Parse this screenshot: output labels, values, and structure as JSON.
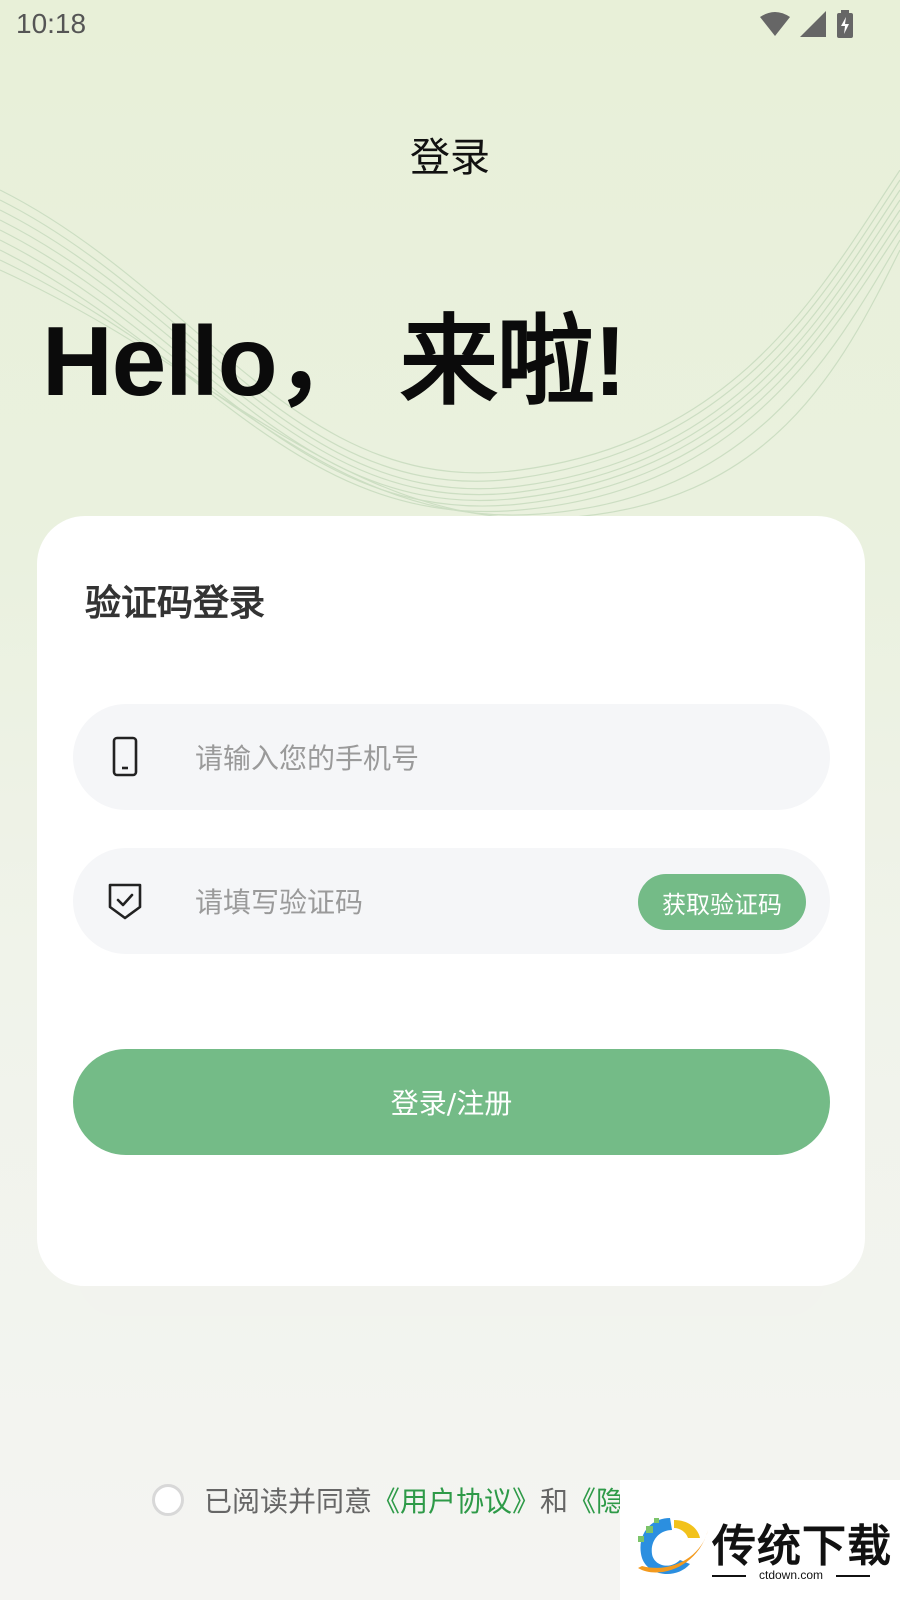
{
  "status_bar": {
    "time": "10:18",
    "icons": [
      "wifi-icon",
      "signal-icon",
      "battery-icon"
    ]
  },
  "header": {
    "title": "登录"
  },
  "hero": {
    "greeting": "Hello，  来啦!"
  },
  "login_card": {
    "title": "验证码登录",
    "phone_input": {
      "placeholder": "请输入您的手机号",
      "value": "",
      "icon": "phone-icon"
    },
    "code_input": {
      "placeholder": "请填写验证码",
      "value": "",
      "icon": "shield-check-icon"
    },
    "get_code_label": "获取验证码",
    "submit_label": "登录/注册"
  },
  "agreement": {
    "checked": false,
    "prefix": "已阅读并同意",
    "user_agreement": "《用户协议》",
    "and": "和",
    "privacy_partial": "《隐"
  },
  "watermark": {
    "brand": "传统下载",
    "domain": "ctdown.com"
  },
  "colors": {
    "accent": "#74bb87",
    "link": "#2e9a48",
    "input_bg": "#f5f6f8"
  }
}
